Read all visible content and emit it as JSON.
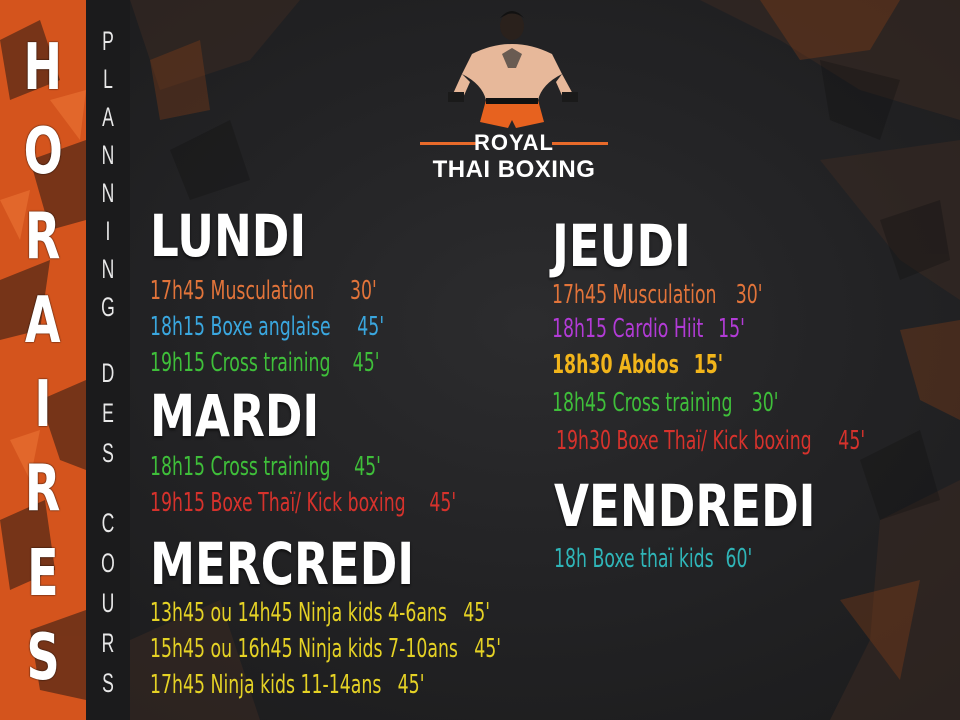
{
  "left_vertical": {
    "word": "HORAIRES",
    "letters": [
      "H",
      "O",
      "R",
      "A",
      "I",
      "R",
      "E",
      "S"
    ]
  },
  "subtitle_vertical": {
    "phrase": "PLANNING DES COURS",
    "letters": [
      "P",
      "L",
      "A",
      "N",
      "N",
      "I",
      "N",
      "G",
      "D",
      "E",
      "S",
      "C",
      "O",
      "U",
      "R",
      "S"
    ]
  },
  "logo": {
    "line1": "ROYAL",
    "line2": "THAI BOXING",
    "accent_color": "#e86a2a"
  },
  "colors": {
    "orange": "#e2743a",
    "blue": "#3aa7df",
    "green": "#3fbf3a",
    "red": "#d6322c",
    "purple": "#b23bd6",
    "yellow": "#f2b51b",
    "teal": "#2fb5b8",
    "lime": "#e5d225",
    "band": "#d4541d"
  },
  "days": {
    "lundi": {
      "title": "LUNDI",
      "classes": [
        {
          "time_name": "17h45 Musculation",
          "duration": "30'",
          "color": "#e2743a"
        },
        {
          "time_name": "18h15 Boxe anglaise",
          "duration": "45'",
          "color": "#3aa7df"
        },
        {
          "time_name": "19h15 Cross training",
          "duration": "45'",
          "color": "#3fbf3a"
        }
      ]
    },
    "mardi": {
      "title": "MARDI",
      "classes": [
        {
          "time_name": "18h15 Cross training",
          "duration": "45'",
          "color": "#3fbf3a"
        },
        {
          "time_name": "19h15 Boxe Thaï/ Kick boxing",
          "duration": "45'",
          "color": "#d6322c"
        }
      ]
    },
    "mercredi": {
      "title": "MERCREDI",
      "classes": [
        {
          "time_name": "13h45 ou 14h45 Ninja kids 4-6ans",
          "duration": "45'",
          "color": "#e5d225"
        },
        {
          "time_name": "15h45 ou 16h45 Ninja kids 7-10ans",
          "duration": "45'",
          "color": "#e5d225"
        },
        {
          "time_name": "17h45  Ninja kids 11-14ans",
          "duration": "45'",
          "color": "#e5d225"
        }
      ]
    },
    "jeudi": {
      "title": "JEUDI",
      "classes": [
        {
          "time_name": "17h45  Musculation",
          "duration": "30'",
          "color": "#e2743a"
        },
        {
          "time_name": "18h15 Cardio Hiit",
          "duration": "15'",
          "color": "#b23bd6"
        },
        {
          "time_name": "18h30 Abdos",
          "duration": "15'",
          "color": "#f2b51b"
        },
        {
          "time_name": "18h45 Cross training",
          "duration": "30'",
          "color": "#3fbf3a"
        },
        {
          "time_name": "19h30 Boxe Thaï/ Kick boxing",
          "duration": "45'",
          "color": "#d6322c"
        }
      ]
    },
    "vendredi": {
      "title": "VENDREDI",
      "classes": [
        {
          "time_name": "18h  Boxe thaï kids",
          "duration": "60'",
          "color": "#2fb5b8"
        }
      ]
    }
  }
}
